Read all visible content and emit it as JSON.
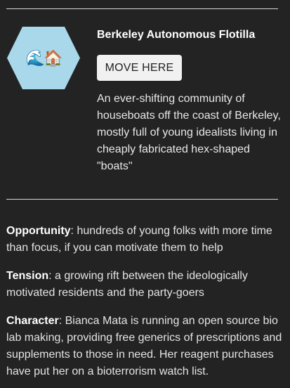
{
  "location": {
    "name": "Berkeley Autonomous Flotilla",
    "icon_glyph": "🌊🏠",
    "icon_semantic": "wave-house-icon",
    "description": "An ever-shifting community of houseboats off the coast of Berkeley, mostly full of young idealists living in cheaply fabricated hex-shaped \"boats\""
  },
  "actions": {
    "move_label": "MOVE HERE"
  },
  "traits": [
    {
      "label": "Opportunity",
      "sep": ": ",
      "text": "hundreds of young folks with more time than focus, if you can motivate them to help"
    },
    {
      "label": "Tension",
      "sep": ": ",
      "text": "a growing rift between the ideologically motivated residents and the party-goers"
    },
    {
      "label": "Character",
      "sep": ": ",
      "text": "Bianca Mata is running an open source bio lab making, providing free generics of prescriptions and supplements to those in need. Her reagent purchases have put her on a bioterrorism watch list."
    }
  ],
  "colors": {
    "background": "#232323",
    "hex_fill": "#a8d8ea",
    "button_bg": "#f1f1f1",
    "rule": "#d8d8d8"
  }
}
